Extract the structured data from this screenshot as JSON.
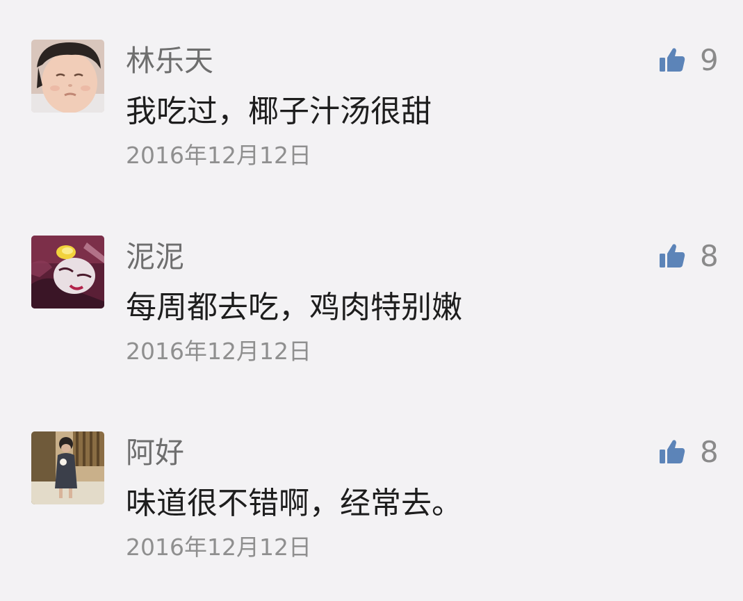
{
  "theme": {
    "background": "#f3f2f4",
    "like_icon_color": "#5c84b8"
  },
  "comments": [
    {
      "avatar_icon": "avatar-child-face",
      "name": "林乐天",
      "text": "我吃过，椰子汁汤很甜",
      "date": "2016年12月12日",
      "likes": "9"
    },
    {
      "avatar_icon": "avatar-costume-face",
      "name": "泥泥",
      "text": "每周都去吃，鸡肉特别嫩",
      "date": "2016年12月12日",
      "likes": "8"
    },
    {
      "avatar_icon": "avatar-child-figure",
      "name": "阿好",
      "text": "味道很不错啊，经常去。",
      "date": "2016年12月12日",
      "likes": "8"
    }
  ]
}
